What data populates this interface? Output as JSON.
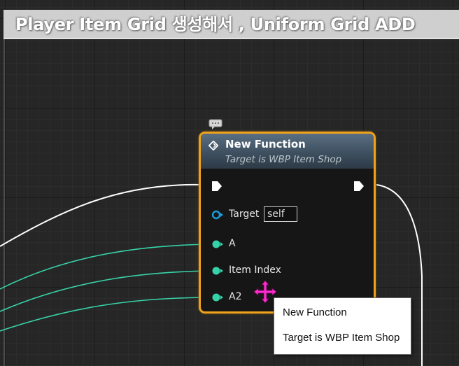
{
  "comment": {
    "title": "Player Item Grid 생성해서 , Uniform Grid ADD"
  },
  "node": {
    "title": "New Function",
    "subtitle": "Target is WBP Item Shop",
    "pins": {
      "target_label": "Target",
      "target_default": "self",
      "a_label": "A",
      "item_index_label": "Item Index",
      "a2_label": "A2"
    }
  },
  "tooltip": {
    "line1": "New Function",
    "line2": "Target is WBP Item Shop"
  },
  "icons": {
    "function": "function-icon",
    "comment_bubble": "comment-bubble-icon",
    "move_cursor": "move-cursor-icon"
  },
  "colors": {
    "node_border": "#f0a21c",
    "exec_wire": "#ffffff",
    "data_wire": "#37d3a8",
    "target_pin": "#1e9ad8",
    "cursor": "#ff2ad0"
  }
}
